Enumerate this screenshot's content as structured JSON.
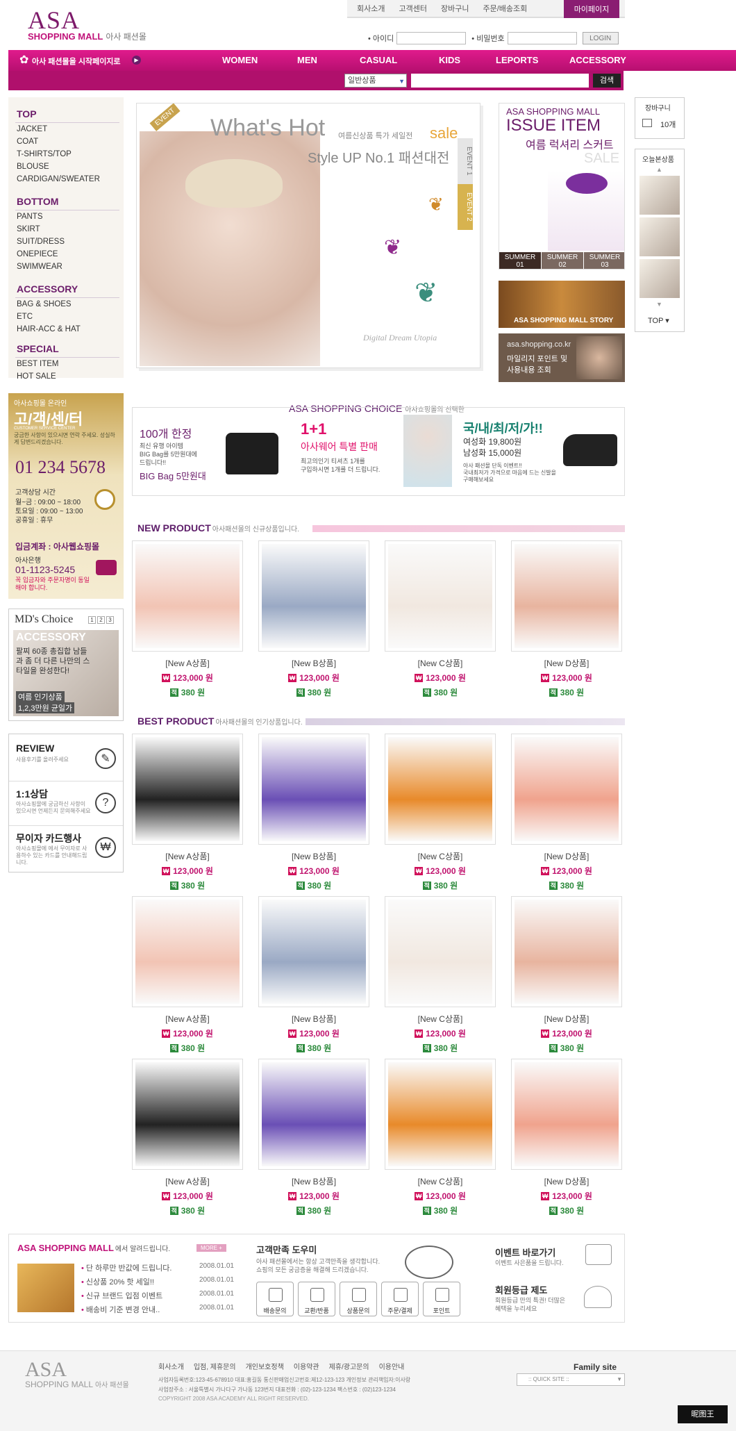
{
  "header": {
    "logo_main": "ASA",
    "logo_sub": "SHOPPING MALL",
    "logo_kr": "아사 패션몰",
    "top_links": [
      "회사소개",
      "고객센터",
      "장바구니",
      "주문/배송조회"
    ],
    "mypage": "마이페이지",
    "id_label": "• 아이디",
    "pw_label": "• 비밀번호",
    "login": "LOGIN"
  },
  "menu": {
    "start_text": "아사 패션몰을 시작페이지로",
    "categories": [
      "WOMEN",
      "MEN",
      "CASUAL",
      "KIDS",
      "LEPORTS",
      "ACCESSORY"
    ],
    "search_select": "일반상품",
    "search_button": "검색"
  },
  "sidebar": {
    "groups": [
      {
        "title": "TOP",
        "items": [
          "JACKET",
          "COAT",
          "T-SHIRTS/TOP",
          "BLOUSE",
          "CARDIGAN/SWEATER"
        ]
      },
      {
        "title": "BOTTOM",
        "items": [
          "PANTS",
          "SKIRT",
          "SUIT/DRESS",
          "ONEPIECE",
          "SWIMWEAR"
        ]
      },
      {
        "title": "ACCESSORY",
        "items": [
          "BAG & SHOES",
          "ETC",
          "HAIR-ACC & HAT"
        ]
      },
      {
        "title": "SPECIAL",
        "items": [
          "BEST ITEM",
          "HOT SALE"
        ]
      }
    ],
    "cs": {
      "top": "아사쇼핑몰 온라인",
      "title": "고/객/센/터",
      "sub": "CUSTOMER SERVICE CENTER",
      "desc": "궁금한 사항이 있으시면 연락 주세요. 성실하게 답변드리겠습니다.",
      "phone": "01 234 5678",
      "hours_title": "고객상담 시간",
      "hours": [
        "월~금 : 09:00 ~ 18:00",
        "토요일 : 09:00 ~ 13:00",
        "공휴일 : 휴무"
      ],
      "account_title": "입금계좌 : 아사웹쇼핑몰",
      "bank": "아사은행",
      "account_no": "01-1123-5245",
      "account_note": "꼭 입금자와 주문자명이 동일해야 합니다."
    },
    "md": {
      "title": "MD's Choice",
      "pages": [
        "1",
        "2",
        "3"
      ],
      "category": "ACCESSORY",
      "desc": "팔찌 60종 총집합 남들과 좀 더 다른 나만의 스타일을 완성한다!",
      "tag1": "여름 인기상품",
      "tag2": "1,2,3만원 균일가"
    },
    "info": [
      {
        "title": "REVIEW",
        "desc": "사용후기를 올려주세요",
        "icon": "pencil-icon"
      },
      {
        "title": "1:1상담",
        "desc": "아사쇼핑몰에 궁금하신 사항이 있으시면 언제든지 문의해주세요",
        "icon": "question-icon"
      },
      {
        "title": "무이자 카드행사",
        "desc": "아사쇼핑몰에 에서 무이자로 사용하수 있는 카드를 안내해드립니다.",
        "icon": "won-icon"
      }
    ]
  },
  "hero": {
    "title": "What's Hot",
    "sale_small": "여름신상품 특가 세일전",
    "sale": "sale",
    "sub": "Style UP No.1 패션대전",
    "tab1": "EVENT 1",
    "tab2": "EVENT 2",
    "ribbon": "EVENT",
    "script": "Digital Dream Utopia"
  },
  "issue": {
    "brand": "ASA SHOPPING MALL",
    "title": "ISSUE ITEM",
    "sub": "여름 럭셔리 스커트",
    "sale": "SALE",
    "tabs": [
      [
        "SUMMER",
        "01"
      ],
      [
        "SUMMER",
        "02"
      ],
      [
        "SUMMER",
        "03"
      ]
    ]
  },
  "story": "ASA SHOPPING MALL STORY",
  "mall_promo": {
    "url": "asa.shopping.co.kr",
    "line1": "마일리지 포인트 및",
    "line2": "사용내용 조회"
  },
  "right_rail": {
    "cart": "장바구니",
    "cart_count": "10개",
    "today": "오늘본상품",
    "top": "TOP"
  },
  "choice": {
    "title": "ASA SHOPPING CHOICE",
    "title_sub": "아사쇼핑몰의 선택한",
    "items": [
      {
        "headline": "100개 한정",
        "lines": [
          "최신 유행 아이템",
          "BIG Bag를 5만원대에",
          "드립니다!!"
        ],
        "strong": "BIG Bag 5만원대"
      },
      {
        "headline": "1+1",
        "strong": "아사웨어 특별 판매",
        "lines": [
          "최고의인기 티셔츠 1개를",
          "구입하시면 1개를 더 드립니다."
        ]
      },
      {
        "headline": "국/내/최/저/가!!",
        "price1": "여성화 19,800원",
        "price2": "남성화 15,000원",
        "lines": [
          "아사 패션몰 단독 이벤트!!",
          "국내최저가 가격으로 마음에 드는 신발을",
          "구매해보세요"
        ]
      }
    ]
  },
  "new_product": {
    "title": "NEW PRODUCT",
    "sub": "아사패션몰의 신규상품입니다.",
    "items": [
      {
        "name": "[New A상품]",
        "price": "123,000 원",
        "point": "380 원"
      },
      {
        "name": "[New B상품]",
        "price": "123,000 원",
        "point": "380 원"
      },
      {
        "name": "[New C상품]",
        "price": "123,000 원",
        "point": "380 원"
      },
      {
        "name": "[New D상품]",
        "price": "123,000 원",
        "point": "380 원"
      }
    ]
  },
  "best_product": {
    "title": "BEST PRODUCT",
    "sub": "아사패션몰의 인기상품입니다.",
    "items": [
      {
        "name": "[New A상품]",
        "price": "123,000 원",
        "point": "380 원"
      },
      {
        "name": "[New B상품]",
        "price": "123,000 원",
        "point": "380 원"
      },
      {
        "name": "[New C상품]",
        "price": "123,000 원",
        "point": "380 원"
      },
      {
        "name": "[New D상품]",
        "price": "123,000 원",
        "point": "380 원"
      },
      {
        "name": "[New A상품]",
        "price": "123,000 원",
        "point": "380 원"
      },
      {
        "name": "[New B상품]",
        "price": "123,000 원",
        "point": "380 원"
      },
      {
        "name": "[New C상품]",
        "price": "123,000 원",
        "point": "380 원"
      },
      {
        "name": "[New D상품]",
        "price": "123,000 원",
        "point": "380 원"
      },
      {
        "name": "[New A상품]",
        "price": "123,000 원",
        "point": "380 원"
      },
      {
        "name": "[New B상품]",
        "price": "123,000 원",
        "point": "380 원"
      },
      {
        "name": "[New C상품]",
        "price": "123,000 원",
        "point": "380 원"
      },
      {
        "name": "[New D상품]",
        "price": "123,000 원",
        "point": "380 원"
      }
    ]
  },
  "price_badge": "₩",
  "point_badge": "적",
  "notice": {
    "brand": "ASA SHOPPING MALL",
    "brand_sub": "에서 알려드립니다.",
    "more": "MORE +",
    "items": [
      {
        "text": "단 하루만 반값에 드립니다.",
        "date": "2008.01.01"
      },
      {
        "text": "신상품 20% 핫 세일!!",
        "date": "2008.01.01"
      },
      {
        "text": "신규 브랜드 입점 이벤트",
        "date": "2008.01.01"
      },
      {
        "text": "배송비 기준 변경 안내..",
        "date": "2008.01.01"
      }
    ],
    "service_title": "고객만족 도우미",
    "service_desc1": "아사 패션몰에서는 항상 고객만족을 생각합니다.",
    "service_desc2": "쇼핑의 모든 궁금증을 해결해 드리겠습니다.",
    "service_buttons": [
      "배송문의",
      "교환/반품",
      "상품문의",
      "주문/결제",
      "포인트"
    ],
    "event_title": "이벤트 바로가기",
    "event_desc": "이벤트 사은품을 드립니다.",
    "member_title": "회원등급 제도",
    "member_desc1": "회원등급 만의 특권! 더많은",
    "member_desc2": "혜택을 누리세요"
  },
  "footer": {
    "logo_main": "ASA",
    "logo_sub": "SHOPPING MALL",
    "logo_kr": "아사 패션몰",
    "links": [
      "회사소개",
      "입점, 제휴문의",
      "개인보호정책",
      "이용약관",
      "제휴/광고문의",
      "이용안내"
    ],
    "line1": "사업자등록번호:123-45-678910   대표:홍길동   통신판매업신고번호:제12-123-123   개인정보 관리책임자:이사랑",
    "line2": "사업장주소 : 서울특별시 가나다구 가나동 123번지   대표전화 : (02)-123-1234   팩스번호 : (02)123-1234",
    "line3": "COPYRIGHT 2008 ASA ACADEMY  ALL RIGHT RESERVED.",
    "family": "Family site",
    "quick": ":: QUICK SITE ::",
    "watermark": "昵图王"
  },
  "colors": {
    "brand": "#c0137a",
    "plum": "#6b1d6a",
    "gold": "#c8a34e"
  }
}
